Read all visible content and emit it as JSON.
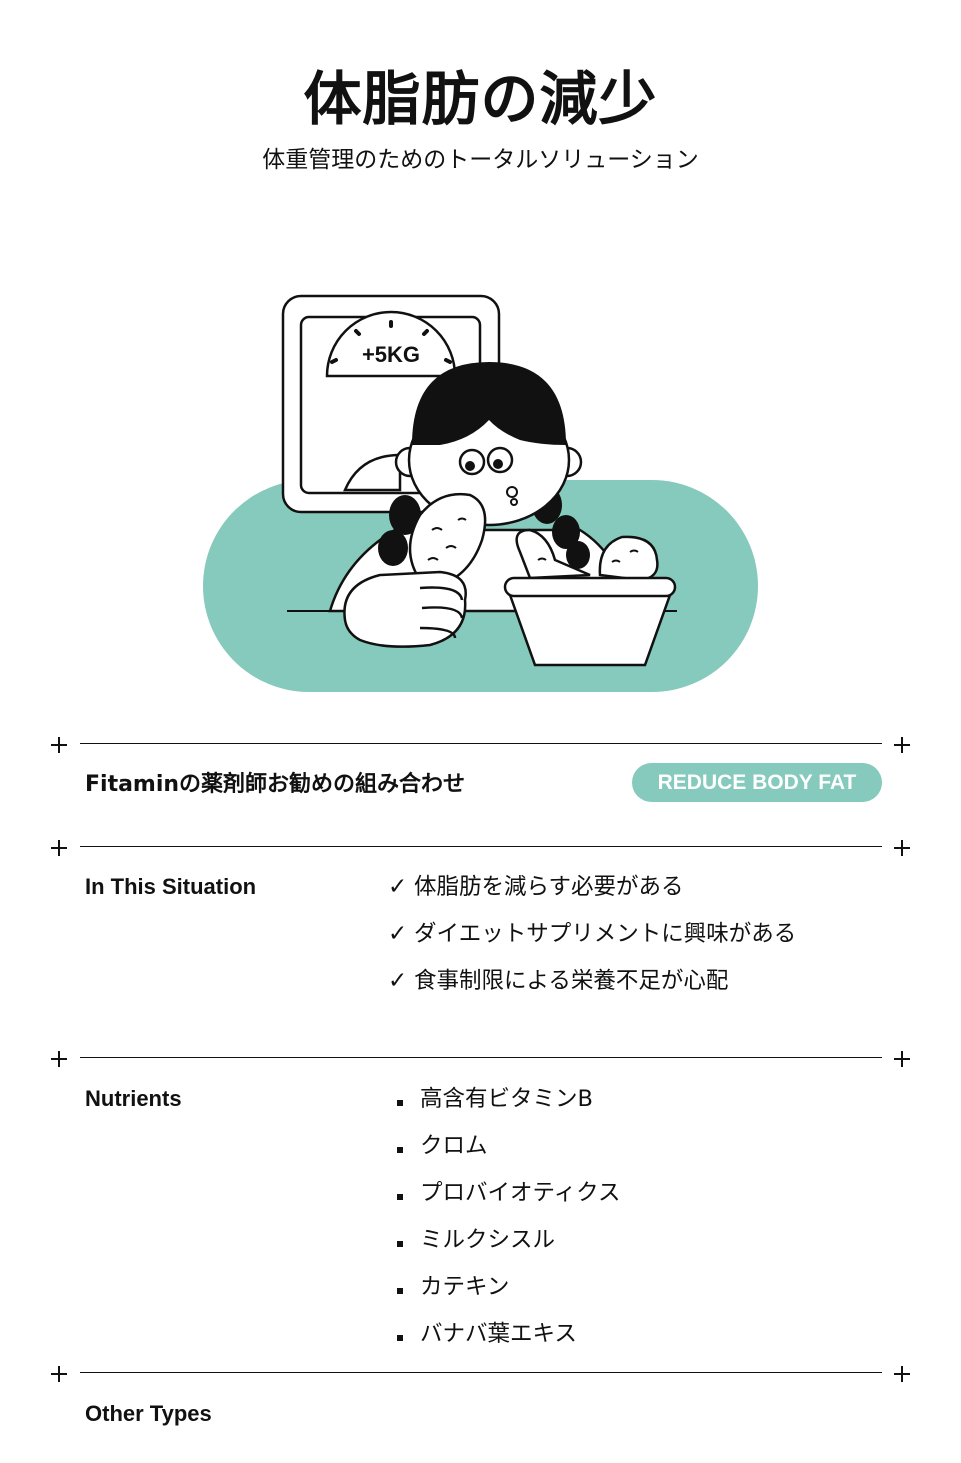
{
  "header": {
    "title": "体脂肪の減少",
    "subtitle": "体重管理のためのトータルソリューション"
  },
  "illustration": {
    "scale_label": "+5KG",
    "accent_color": "#86C9BD"
  },
  "recommendation": {
    "title": "Fitaminの薬剤師お勧めの組み合わせ",
    "badge": "REDUCE BODY FAT"
  },
  "situation": {
    "title": "In This Situation",
    "check_mark": "✓",
    "items": [
      "体脂肪を減らす必要がある",
      "ダイエットサプリメントに興味がある",
      "食事制限による栄養不足が心配"
    ]
  },
  "nutrients": {
    "title": "Nutrients",
    "items": [
      "高含有ビタミンB",
      "クロム",
      "プロバイオティクス",
      "ミルクシスル",
      "カテキン",
      "バナバ葉エキス"
    ]
  },
  "other_types": {
    "title": "Other Types"
  }
}
